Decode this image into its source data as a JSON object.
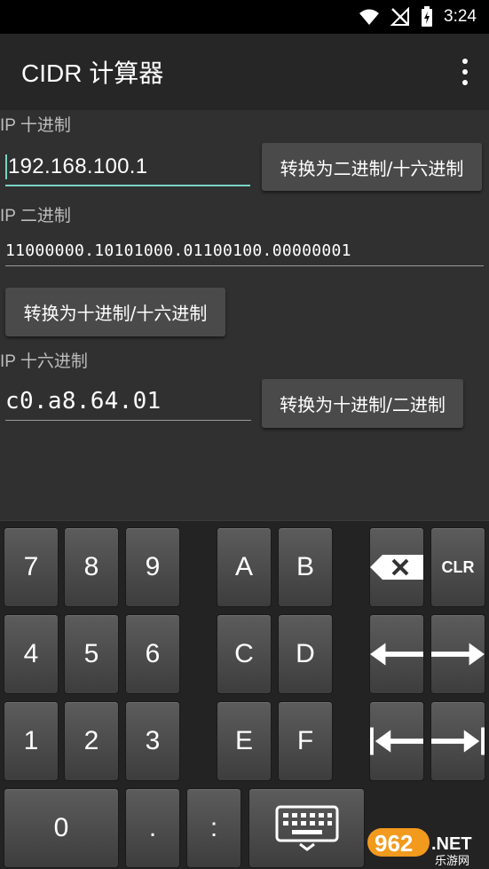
{
  "status_bar": {
    "time": "3:24"
  },
  "app_bar": {
    "title": "CIDR 计算器"
  },
  "decimal": {
    "label": "IP 十进制",
    "value": "192.168.100.1",
    "button": "转换为二进制/十六进制"
  },
  "binary": {
    "label": "IP 二进制",
    "value": "11000000.10101000.01100100.00000001",
    "button": "转换为十进制/十六进制"
  },
  "hex": {
    "label": "IP 十六进制",
    "value": "c0.a8.64.01",
    "button": "转换为十进制/二进制"
  },
  "keyboard": {
    "keys": [
      "7",
      "8",
      "9",
      "A",
      "B",
      "4",
      "5",
      "6",
      "C",
      "D",
      "1",
      "2",
      "3",
      "E",
      "F",
      "0",
      ".",
      ":"
    ],
    "clr_label": "CLR"
  },
  "watermark": "962.NET 乐游网",
  "colors": {
    "accent": "#7ad3c6",
    "app_bar": "#262626",
    "content_bg": "#303030",
    "button_bg": "#4a4a4a"
  }
}
